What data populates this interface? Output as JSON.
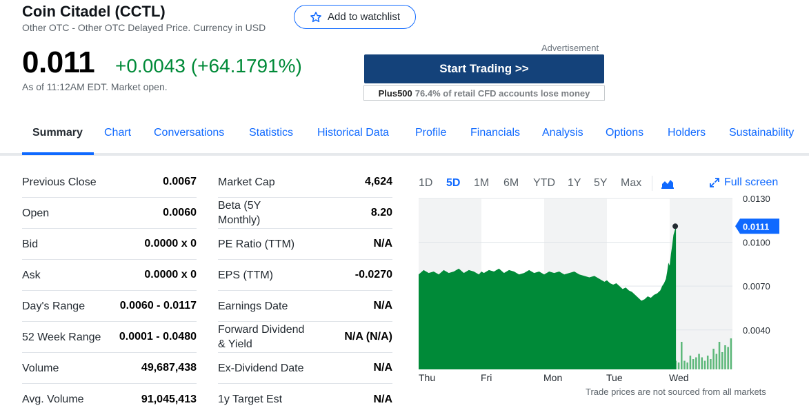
{
  "header": {
    "title": "Coin Citadel (CCTL)",
    "subtitle": "Other OTC - Other OTC Delayed Price. Currency in USD",
    "watchlist_label": "Add to watchlist"
  },
  "quote": {
    "price": "0.011",
    "change": "+0.0043 (+64.1791%)",
    "as_of": "As of 11:12AM EDT. Market open."
  },
  "ad": {
    "label": "Advertisement",
    "button": "Start Trading >>",
    "brand": "Plus500",
    "disclaimer": "76.4% of retail CFD accounts lose money"
  },
  "tabs": [
    {
      "label": "Summary",
      "active": true
    },
    {
      "label": "Chart"
    },
    {
      "label": "Conversations"
    },
    {
      "label": "Statistics"
    },
    {
      "label": "Historical Data"
    },
    {
      "label": "Profile"
    },
    {
      "label": "Financials"
    },
    {
      "label": "Analysis"
    },
    {
      "label": "Options"
    },
    {
      "label": "Holders"
    },
    {
      "label": "Sustainability"
    }
  ],
  "stats_left": [
    {
      "label": "Previous Close",
      "value": "0.0067"
    },
    {
      "label": "Open",
      "value": "0.0060"
    },
    {
      "label": "Bid",
      "value": "0.0000 x 0"
    },
    {
      "label": "Ask",
      "value": "0.0000 x 0"
    },
    {
      "label": "Day's Range",
      "value": "0.0060 - 0.0117"
    },
    {
      "label": "52 Week Range",
      "value": "0.0001 - 0.0480"
    },
    {
      "label": "Volume",
      "value": "49,687,438"
    },
    {
      "label": "Avg. Volume",
      "value": "91,045,413"
    }
  ],
  "stats_right": [
    {
      "label": "Market Cap",
      "value": "4,624"
    },
    {
      "label": "Beta (5Y Monthly)",
      "value": "8.20"
    },
    {
      "label": "PE Ratio (TTM)",
      "value": "N/A"
    },
    {
      "label": "EPS (TTM)",
      "value": "-0.0270"
    },
    {
      "label": "Earnings Date",
      "value": "N/A"
    },
    {
      "label": "Forward Dividend & Yield",
      "value": "N/A (N/A)"
    },
    {
      "label": "Ex-Dividend Date",
      "value": "N/A"
    },
    {
      "label": "1y Target Est",
      "value": "N/A"
    }
  ],
  "chart": {
    "ranges": [
      "1D",
      "5D",
      "1M",
      "6M",
      "YTD",
      "1Y",
      "5Y",
      "Max"
    ],
    "active_range": "5D",
    "chart-type-icon": "mountain-chart-icon",
    "fullscreen_label": "Full screen",
    "note": "Trade prices are not sourced from all markets",
    "accent_color": "#0f69ff",
    "fill_color": "#008a38"
  },
  "chart_data": {
    "type": "area",
    "x_categories": [
      "Thu",
      "Fri",
      "Mon",
      "Tue",
      "Wed"
    ],
    "y_ticks": [
      "0.0130",
      "0.0100",
      "0.0070",
      "0.0040"
    ],
    "ylim": [
      0.0013,
      0.013
    ],
    "current_label": "0.0111",
    "current_value": 0.0111,
    "grid": true,
    "series": [
      {
        "x": [
          0,
          0.08,
          0.16,
          0.24,
          0.32,
          0.4,
          0.48,
          0.56,
          0.64,
          0.72,
          0.8,
          0.88,
          0.96,
          1.0,
          1.04,
          1.12,
          1.2,
          1.28,
          1.36,
          1.44,
          1.52,
          1.6,
          1.68,
          1.76,
          1.84,
          1.92,
          2.0,
          2.08,
          2.16,
          2.24,
          2.32,
          2.4,
          2.48,
          2.56,
          2.64,
          2.72,
          2.8,
          2.88,
          2.96,
          3.0,
          3.05,
          3.1,
          3.15,
          3.2,
          3.25,
          3.3,
          3.35,
          3.4,
          3.45,
          3.5,
          3.55,
          3.6,
          3.65,
          3.7,
          3.75,
          3.8,
          3.85,
          3.88,
          3.91,
          3.94,
          3.96,
          3.98,
          4.0,
          4.02,
          4.04,
          4.06,
          4.08,
          4.1
        ],
        "y": [
          0.0078,
          0.0081,
          0.0079,
          0.008,
          0.0078,
          0.0081,
          0.0079,
          0.008,
          0.0082,
          0.0079,
          0.0081,
          0.008,
          0.0078,
          0.008,
          0.0079,
          0.0081,
          0.008,
          0.0082,
          0.0079,
          0.0081,
          0.008,
          0.0078,
          0.0079,
          0.0081,
          0.0079,
          0.008,
          0.0078,
          0.008,
          0.0079,
          0.008,
          0.0078,
          0.0079,
          0.008,
          0.0078,
          0.0077,
          0.0076,
          0.0077,
          0.0075,
          0.0073,
          0.0074,
          0.0072,
          0.0071,
          0.0072,
          0.007,
          0.0068,
          0.0069,
          0.0067,
          0.0066,
          0.0064,
          0.0062,
          0.006,
          0.0061,
          0.0063,
          0.0062,
          0.0064,
          0.0065,
          0.0067,
          0.007,
          0.0072,
          0.0075,
          0.008,
          0.0086,
          0.0084,
          0.0092,
          0.0098,
          0.0105,
          0.0108,
          0.0111
        ]
      }
    ],
    "volume": [
      3,
      2,
      3,
      2,
      4,
      2,
      3,
      2,
      3,
      4,
      2,
      3,
      2,
      3,
      3,
      2,
      4,
      3,
      2,
      3,
      2,
      3,
      2,
      4,
      3,
      5,
      3,
      2,
      3,
      4,
      2,
      3,
      8,
      3,
      2,
      3,
      2,
      4,
      3,
      2,
      3,
      2,
      3,
      5,
      3,
      2,
      3,
      2,
      4,
      3,
      2,
      3,
      4,
      2,
      3,
      2,
      3,
      2,
      3,
      4,
      3,
      2,
      5,
      3,
      4,
      3,
      5,
      4,
      3,
      6,
      4,
      3,
      7,
      4,
      3,
      5,
      4,
      3,
      5,
      4,
      3,
      4,
      3,
      14,
      4,
      3,
      4,
      6,
      5,
      4,
      16,
      5,
      4,
      8,
      6,
      7,
      9,
      7,
      5,
      8,
      6,
      12,
      9,
      16,
      10,
      14,
      13,
      18
    ]
  }
}
